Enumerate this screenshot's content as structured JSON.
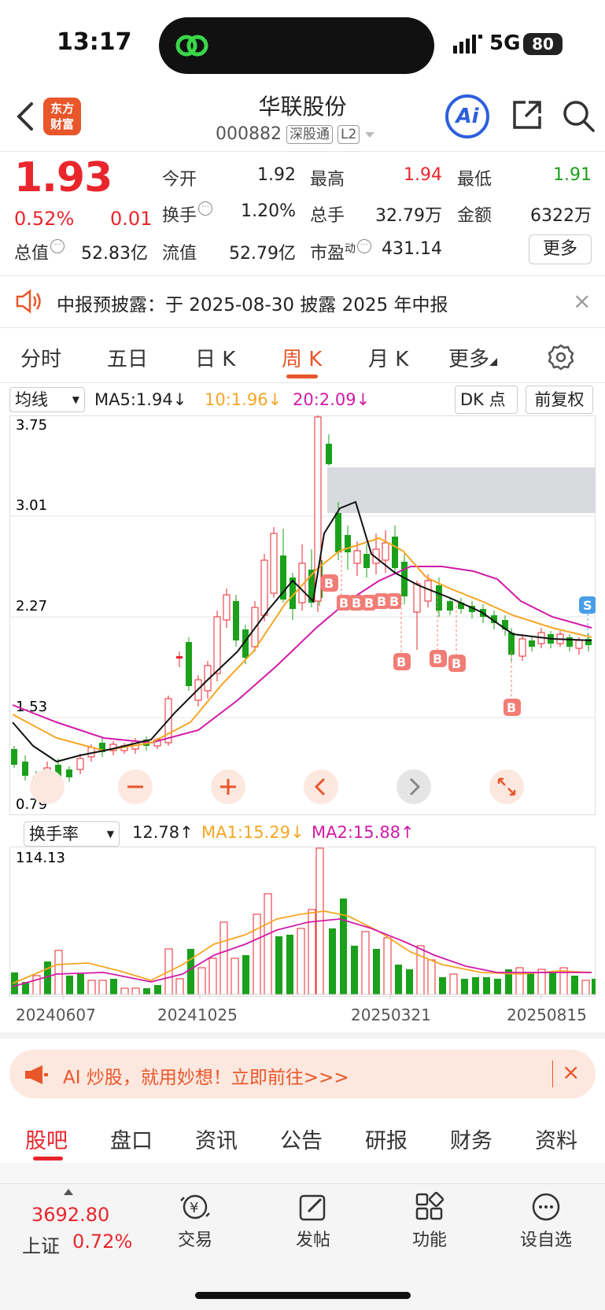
{
  "status": {
    "time": "13:17",
    "network": "5G",
    "battery": "80"
  },
  "header": {
    "logo": "东方财富",
    "stock_name": "华联股份",
    "stock_code": "000882",
    "tag_connect": "深股通",
    "tag_level": "L2",
    "ai_label": "Ai"
  },
  "quote": {
    "price": "1.93",
    "change_pct": "0.52%",
    "change_abs": "0.01",
    "open_label": "今开",
    "open": "1.92",
    "high_label": "最高",
    "high": "1.94",
    "low_label": "最低",
    "low": "1.91",
    "turnover_label": "换手",
    "turnover": "1.20%",
    "volume_label": "总手",
    "volume": "32.79万",
    "amount_label": "金额",
    "amount": "6322万",
    "mktcap_label": "总值",
    "mktcap": "52.83亿",
    "float_label": "流值",
    "float": "52.79亿",
    "pe_label": "市盈",
    "pe_sup": "动",
    "pe": "431.14",
    "more_label": "更多"
  },
  "notice": {
    "text": "中报预披露：于 2025-08-30 披露 2025 年中报"
  },
  "period_tabs": [
    "分时",
    "五日",
    "日 K",
    "周 K",
    "月 K",
    "更多"
  ],
  "active_period": 3,
  "indicator": {
    "select": "均线",
    "ma5": "MA5:1.94",
    "ma10": "10:1.96",
    "ma20": "20:2.09",
    "dk_label": "DK 点",
    "adjust_label": "前复权"
  },
  "volume_indicator": {
    "select": "换手率",
    "value": "12.78",
    "ma1": "MA1:15.29",
    "ma2": "MA2:15.88"
  },
  "chart": {
    "price_ticks": [
      "3.75",
      "3.01",
      "2.27",
      "1.53",
      "0.79"
    ],
    "vol_tick": "114.13",
    "date_ticks": [
      "20240607",
      "20241025",
      "20250321",
      "20250815"
    ],
    "buy_marker": "B",
    "sell_marker": "S",
    "colors": {
      "up": "#e8262c",
      "down": "#1aa01a",
      "ma5": "#111111",
      "ma10": "#f5a623",
      "ma20": "#d21aa8"
    }
  },
  "banner": {
    "text": "AI 炒股，就用妙想！立即前往>>>"
  },
  "section_tabs": [
    "股吧",
    "盘口",
    "资讯",
    "公告",
    "研报",
    "财务",
    "资料"
  ],
  "active_section": 0,
  "bottom_nav": {
    "index_value": "3692.80",
    "index_name": "上证",
    "index_change": "0.72%",
    "items": [
      "交易",
      "发帖",
      "功能",
      "设自选"
    ]
  }
}
